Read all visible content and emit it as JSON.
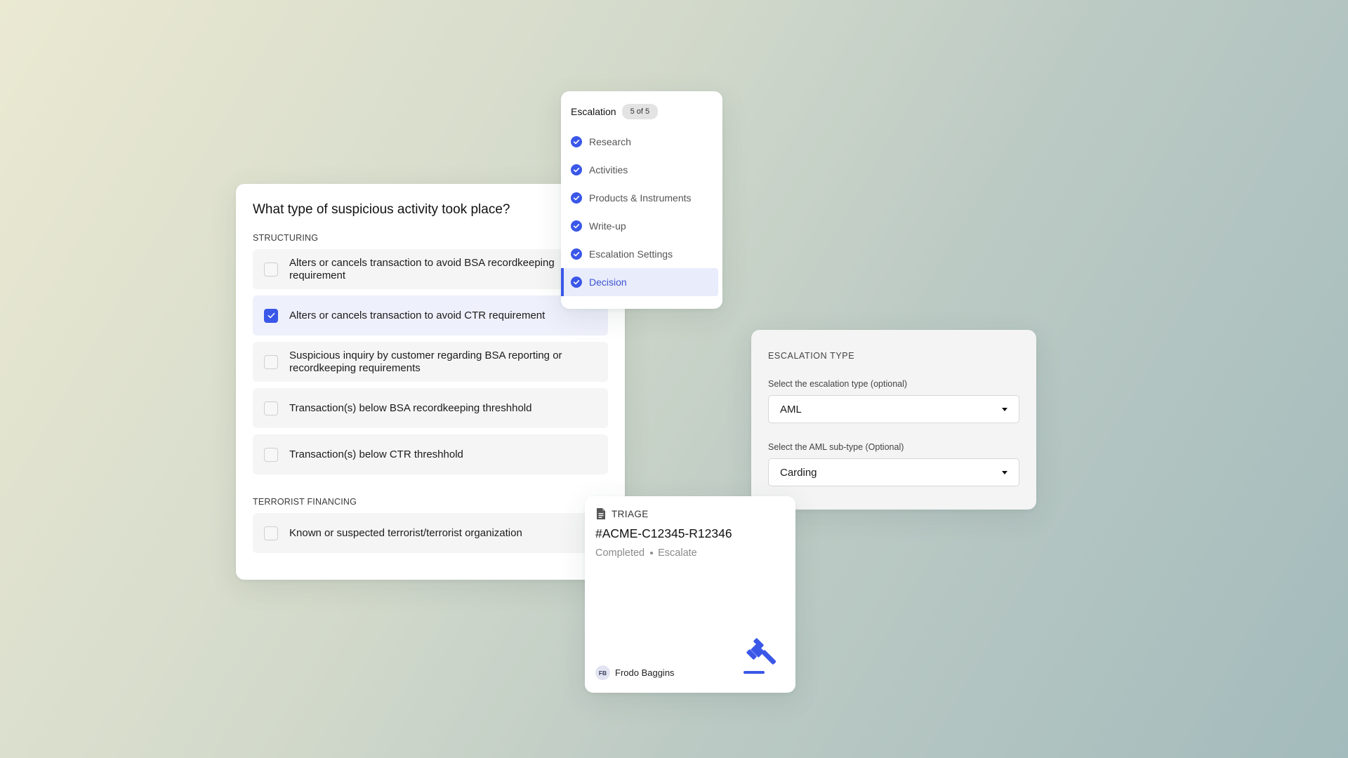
{
  "question_card": {
    "title": "What type of suspicious activity took place?",
    "sections": [
      {
        "label": "STRUCTURING",
        "options": [
          {
            "text": "Alters or cancels transaction to avoid BSA recordkeeping requirement",
            "checked": false
          },
          {
            "text": "Alters or cancels transaction to avoid CTR requirement",
            "checked": true
          },
          {
            "text": "Suspicious inquiry by customer regarding BSA reporting or recordkeeping requirements",
            "checked": false
          },
          {
            "text": "Transaction(s) below BSA recordkeeping threshhold",
            "checked": false
          },
          {
            "text": "Transaction(s) below CTR threshhold",
            "checked": false
          }
        ]
      },
      {
        "label": "TERRORIST FINANCING",
        "options": [
          {
            "text": "Known or suspected terrorist/terrorist organization",
            "checked": false
          }
        ]
      }
    ]
  },
  "steps_card": {
    "title": "Escalation",
    "badge": "5 of 5",
    "steps": [
      {
        "label": "Research",
        "active": false
      },
      {
        "label": "Activities",
        "active": false
      },
      {
        "label": "Products & Instruments",
        "active": false
      },
      {
        "label": "Write-up",
        "active": false
      },
      {
        "label": "Escalation Settings",
        "active": false
      },
      {
        "label": "Decision",
        "active": true
      }
    ]
  },
  "escalation_card": {
    "heading": "ESCALATION TYPE",
    "type_label": "Select the escalation type (optional)",
    "type_value": "AML",
    "subtype_label": "Select the AML sub-type (Optional)",
    "subtype_value": "Carding"
  },
  "triage_card": {
    "label": "TRIAGE",
    "case_id": "#ACME-C12345-R12346",
    "status": "Completed",
    "outcome": "Escalate",
    "user_initials": "FB",
    "user_name": "Frodo Baggins",
    "icon": "gavel-icon"
  },
  "colors": {
    "accent": "#3a57e8",
    "selected_bg": "#eef0fb",
    "option_bg": "#f5f5f5"
  }
}
